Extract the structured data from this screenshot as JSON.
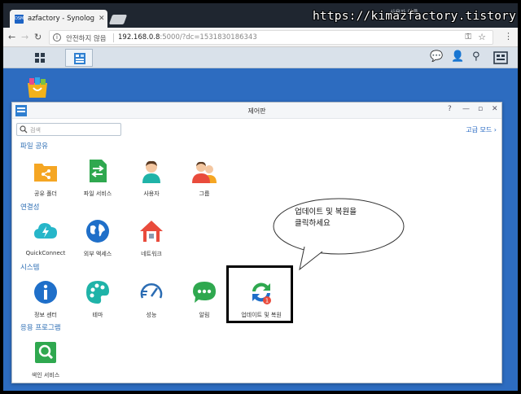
{
  "browser": {
    "tab_title": "azfactory - Synology Di",
    "tab_favicon": "DSM",
    "user_label": "사용자 이름",
    "security_warning": "안전하지 않음",
    "url_host": "192.168.0.8",
    "url_rest": ":5000/?dc=1531830186343"
  },
  "watermark": "https://kimazfactory.tistory.com",
  "window": {
    "title": "제어판",
    "search_placeholder": "검색",
    "advanced_mode": "고급 모드"
  },
  "sections": {
    "file_sharing": {
      "title": "파일 공유",
      "items": [
        "공유 폴더",
        "파일 서비스",
        "사용자",
        "그룹"
      ]
    },
    "connectivity": {
      "title": "연결성",
      "items": [
        "QuickConnect",
        "외부 액세스",
        "네트워크"
      ]
    },
    "system": {
      "title": "시스템",
      "items": [
        "정보 센터",
        "테마",
        "성능",
        "알림",
        "업데이트 및 복원"
      ]
    },
    "applications": {
      "title": "응용 프로그램",
      "items": [
        "색인 서비스"
      ]
    }
  },
  "update_badge": "1",
  "callout": {
    "line1": "업데이트 및 복원을",
    "line2": "클릭하세요"
  },
  "colors": {
    "desktop": "#2d6cc0",
    "section_title": "#2b6cb3",
    "highlight_border": "#000000"
  }
}
